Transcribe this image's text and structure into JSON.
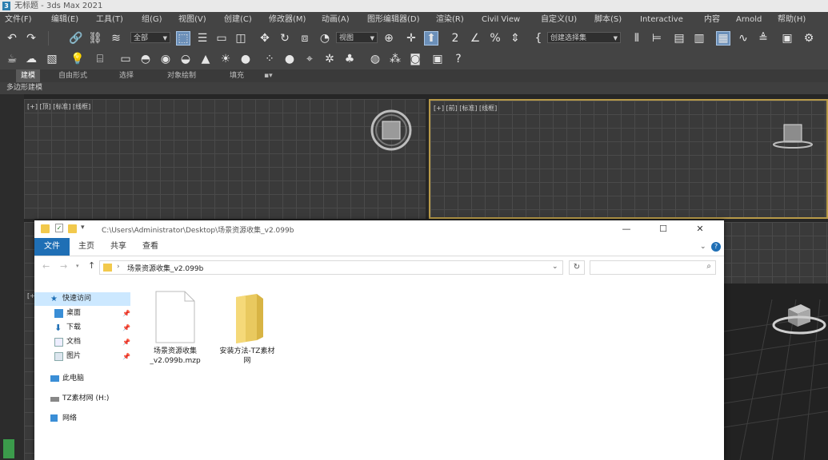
{
  "app": {
    "title": "无标题 - 3ds Max 2021"
  },
  "menu": [
    "文件(F)",
    "编辑(E)",
    "工具(T)",
    "组(G)",
    "视图(V)",
    "创建(C)",
    "修改器(M)",
    "动画(A)",
    "图形编辑器(D)",
    "渲染(R)",
    "Civil View",
    "自定义(U)",
    "脚本(S)",
    "Interactive",
    "内容",
    "Arnold",
    "帮助(H)"
  ],
  "toolbar": {
    "selection_filter": "全部",
    "ref_coord": "视图",
    "named_selection": "创建选择集"
  },
  "ribbon": {
    "tabs": [
      "建模",
      "自由形式",
      "选择",
      "对象绘制",
      "填充"
    ],
    "sub_label": "多边形建模"
  },
  "viewports": {
    "top_left_label": "[+] [顶] [标准] [线框]",
    "top_right_label": "[+] [前] [标准] [线框]",
    "left_small_label": "[+]"
  },
  "explorer": {
    "path_title": "C:\\Users\\Administrator\\Desktop\\场景资源收集_v2.099b",
    "tabs": {
      "file": "文件",
      "home": "主页",
      "share": "共享",
      "view": "查看"
    },
    "address": "场景资源收集_v2.099b",
    "sidebar": {
      "quick_access": "快速访问",
      "desktop": "桌面",
      "downloads": "下载",
      "documents": "文档",
      "pictures": "图片",
      "this_pc": "此电脑",
      "drive": "TZ素材网 (H:)",
      "network": "网络"
    },
    "files": [
      {
        "name": "场景资源收集_v2.099b.mzp",
        "type": "file"
      },
      {
        "name": "安装方法-TZ素材网",
        "type": "folder"
      }
    ]
  },
  "colors": {
    "accent": "#1f6fb5",
    "active_viewport_border": "#b89a48",
    "selection_bg": "#cce8ff"
  }
}
